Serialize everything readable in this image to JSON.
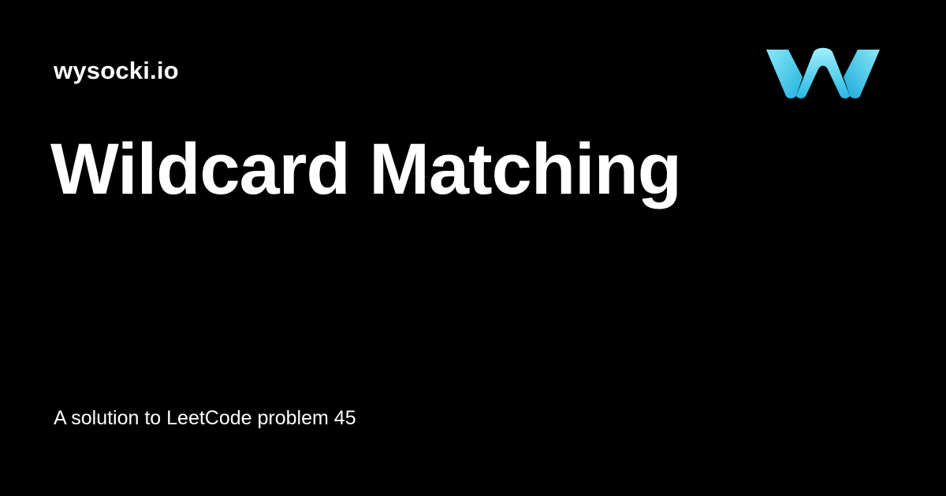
{
  "site": {
    "name": "wysocki.io"
  },
  "article": {
    "title": "Wildcard Matching",
    "subtitle": "A solution to LeetCode problem 45"
  },
  "logo": {
    "icon": "wysocki-w-logo-icon",
    "colors": {
      "light": "#7fe3f5",
      "mid": "#3fc8ec",
      "dark": "#17a9d8"
    }
  }
}
